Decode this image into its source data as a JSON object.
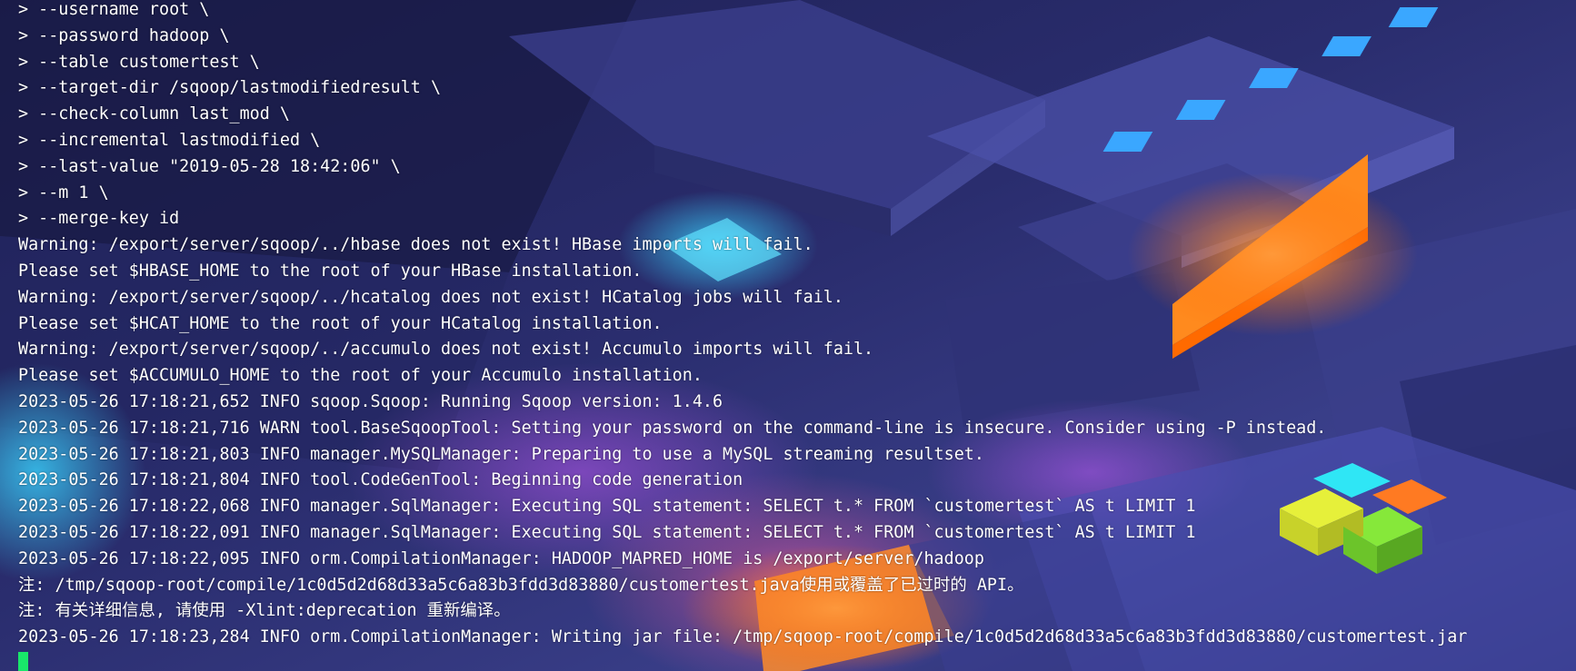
{
  "terminal": {
    "lines": [
      "> --username root \\",
      "> --password hadoop \\",
      "> --table customertest \\",
      "> --target-dir /sqoop/lastmodifiedresult \\",
      "> --check-column last_mod \\",
      "> --incremental lastmodified \\",
      "> --last-value \"2019-05-28 18:42:06\" \\",
      "> --m 1 \\",
      "> --merge-key id",
      "Warning: /export/server/sqoop/../hbase does not exist! HBase imports will fail.",
      "Please set $HBASE_HOME to the root of your HBase installation.",
      "Warning: /export/server/sqoop/../hcatalog does not exist! HCatalog jobs will fail.",
      "Please set $HCAT_HOME to the root of your HCatalog installation.",
      "Warning: /export/server/sqoop/../accumulo does not exist! Accumulo imports will fail.",
      "Please set $ACCUMULO_HOME to the root of your Accumulo installation.",
      "2023-05-26 17:18:21,652 INFO sqoop.Sqoop: Running Sqoop version: 1.4.6",
      "2023-05-26 17:18:21,716 WARN tool.BaseSqoopTool: Setting your password on the command-line is insecure. Consider using -P instead.",
      "2023-05-26 17:18:21,803 INFO manager.MySQLManager: Preparing to use a MySQL streaming resultset.",
      "2023-05-26 17:18:21,804 INFO tool.CodeGenTool: Beginning code generation",
      "2023-05-26 17:18:22,068 INFO manager.SqlManager: Executing SQL statement: SELECT t.* FROM `customertest` AS t LIMIT 1",
      "2023-05-26 17:18:22,091 INFO manager.SqlManager: Executing SQL statement: SELECT t.* FROM `customertest` AS t LIMIT 1",
      "2023-05-26 17:18:22,095 INFO orm.CompilationManager: HADOOP_MAPRED_HOME is /export/server/hadoop",
      "注: /tmp/sqoop-root/compile/1c0d5d2d68d33a5c6a83b3fdd3d83880/customertest.java使用或覆盖了已过时的 API。",
      "注: 有关详细信息, 请使用 -Xlint:deprecation 重新编译。",
      "2023-05-26 17:18:23,284 INFO orm.CompilationManager: Writing jar file: /tmp/sqoop-root/compile/1c0d5d2d68d33a5c6a83b3fdd3d83880/customertest.jar"
    ]
  },
  "colors": {
    "text": "#ffffff",
    "cursor": "#19e66a",
    "background": "#1c1f4a"
  }
}
